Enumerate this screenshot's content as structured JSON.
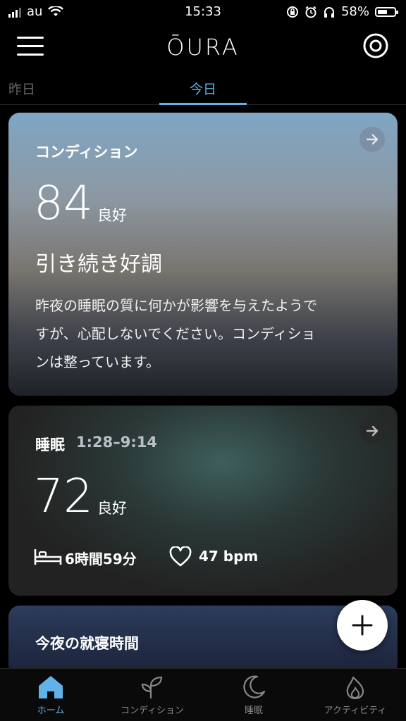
{
  "status_bar": {
    "carrier": "au",
    "time": "15:33",
    "battery": "58%",
    "battery_level": 0.58
  },
  "header": {
    "logo": "ŌURA",
    "menu_icon": "hamburger-menu-icon",
    "ring_icon": "ring-icon"
  },
  "tabs": [
    {
      "label": "昨日",
      "active": false
    },
    {
      "label": "今日",
      "active": true
    }
  ],
  "readiness_card": {
    "title": "コンディション",
    "score": "84",
    "score_label": "良好",
    "headline": "引き続き好調",
    "description": [
      "昨夜の睡眠の質に何かが影響を与えたようで",
      "すが、心配しないでください。コンディショ",
      "ンは整っています。"
    ]
  },
  "sleep_card": {
    "title": "睡眠",
    "time_range": "1:28–9:14",
    "score": "72",
    "score_label": "良好",
    "duration": "6時間59分",
    "heart_rate": "47 bpm"
  },
  "bedtime_card": {
    "title": "今夜の就寝時間"
  },
  "fab": {
    "icon": "plus-icon"
  },
  "bottom_nav": [
    {
      "label": "ホーム",
      "icon": "home-icon",
      "active": true
    },
    {
      "label": "コンディション",
      "icon": "sprout-icon",
      "active": false
    },
    {
      "label": "睡眠",
      "icon": "moon-icon",
      "active": false
    },
    {
      "label": "アクティビティ",
      "icon": "flame-icon",
      "active": false
    }
  ],
  "colors": {
    "accent": "#5fb3e8",
    "background": "#000000"
  }
}
